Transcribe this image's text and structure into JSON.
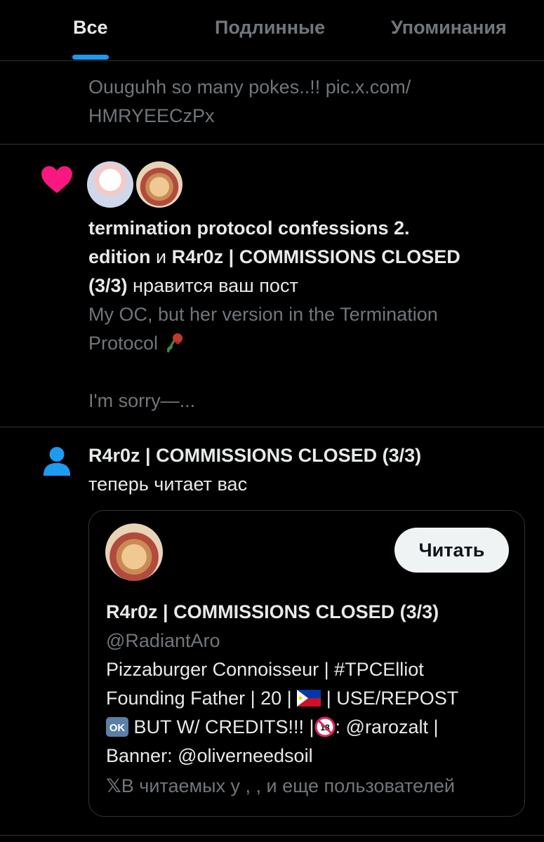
{
  "tabs": [
    {
      "label": "Все",
      "active": true
    },
    {
      "label": "Подлинные",
      "active": false
    },
    {
      "label": "Упоминания",
      "active": false
    }
  ],
  "post0": {
    "line1": "Ouuguhh so many pokes..!! pic.x.com/",
    "line2": "HMRYEECzPx"
  },
  "like_notification": {
    "icon": "heart-icon",
    "icon_color": "#f91880",
    "user1": "termination protocol confessions 2.",
    "user1_cont": "edition",
    "and": " и ",
    "user2": "R4r0z | COMMISSIONS CLOSED",
    "user2_cont": "(3/3)",
    "action": " нравится ваш пост",
    "post_text_1": "My OC, but her version in the Termination",
    "post_text_2": "Protocol",
    "post_text_3": "I'm sorry—..."
  },
  "follow_notification": {
    "icon": "person-icon",
    "icon_color": "#1d9bf0",
    "user": "R4r0z | COMMISSIONS CLOSED (3/3)",
    "action": "теперь читает вас",
    "card": {
      "name": "R4r0z | COMMISSIONS CLOSED (3/3)",
      "handle": "@RadiantAro",
      "bio_1": "Pizzaburger Connoisseur | #TPCElliot",
      "bio_2a": "Founding Father | 20 | ",
      "bio_2b": " | USE/REPOST",
      "bio_3a": " BUT W/ CREDITS!!! |",
      "bio_3b": ": @rarozalt |",
      "bio_4": "Banner: @oliverneedsoil",
      "follow_button": "Читать",
      "followers_line": "В читаемых у , , и еще пользователей"
    }
  }
}
